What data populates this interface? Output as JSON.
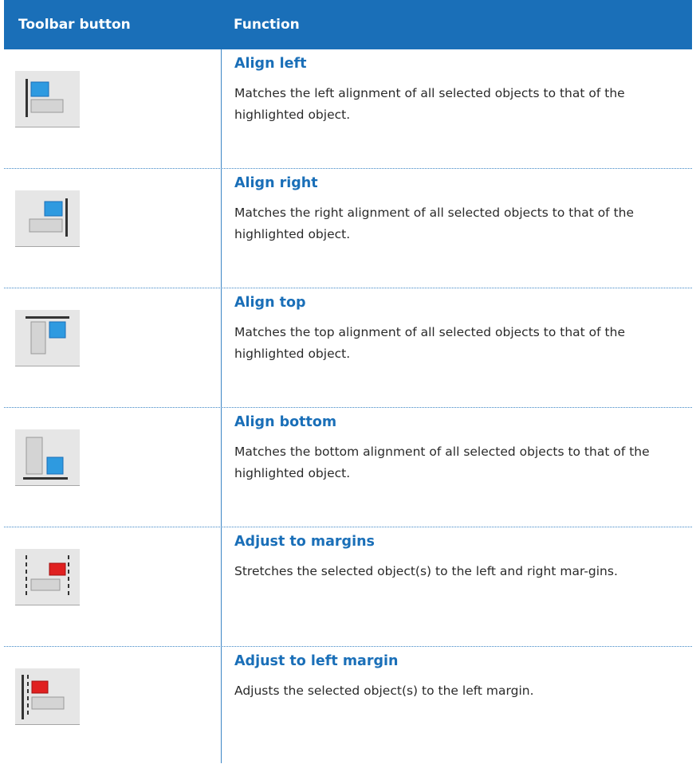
{
  "header": {
    "col1": "Toolbar button",
    "col2": "Function"
  },
  "rows": [
    {
      "icon": "align-left-icon",
      "title": "Align left",
      "desc": "Matches the left alignment of all selected objects to that of the highlighted object."
    },
    {
      "icon": "align-right-icon",
      "title": "Align right",
      "desc": "Matches the right alignment of all selected objects to that of the highlighted object."
    },
    {
      "icon": "align-top-icon",
      "title": "Align top",
      "desc": "Matches the top alignment of all selected objects to that of the highlighted object."
    },
    {
      "icon": "align-bottom-icon",
      "title": "Align bottom",
      "desc": "Matches the bottom alignment of all selected objects to that of the highlighted object."
    },
    {
      "icon": "adjust-to-margins-icon",
      "title": "Adjust to margins",
      "desc": "Stretches the selected object(s) to the left and right mar-gins."
    },
    {
      "icon": "adjust-to-left-margin-icon",
      "title": "Adjust to left margin",
      "desc": "Adjusts the selected object(s) to the left margin."
    }
  ],
  "colors": {
    "header_bg": "#1a6fb8",
    "title": "#1a6fb8",
    "rule": "#3d86c6",
    "blue_box": "#2e9ae0",
    "red_box": "#e02020"
  }
}
